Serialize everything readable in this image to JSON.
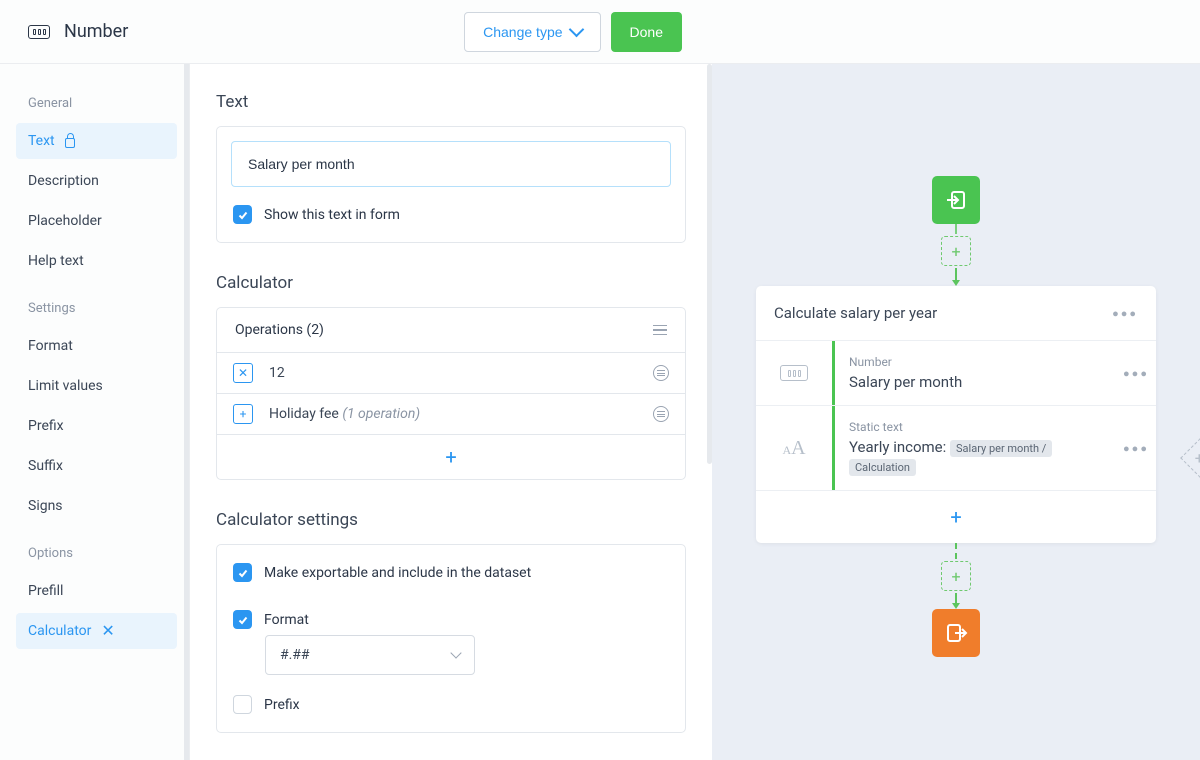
{
  "header": {
    "title": "Number",
    "change_type": "Change type",
    "done": "Done"
  },
  "sidebar": {
    "sections": [
      {
        "label": "General",
        "items": [
          {
            "label": "Text",
            "active": true,
            "locked": true
          },
          {
            "label": "Description"
          },
          {
            "label": "Placeholder"
          },
          {
            "label": "Help text"
          }
        ]
      },
      {
        "label": "Settings",
        "items": [
          {
            "label": "Format"
          },
          {
            "label": "Limit values"
          },
          {
            "label": "Prefix"
          },
          {
            "label": "Suffix"
          },
          {
            "label": "Signs"
          }
        ]
      },
      {
        "label": "Options",
        "items": [
          {
            "label": "Prefill"
          },
          {
            "label": "Calculator",
            "active": true,
            "closable": true
          }
        ]
      }
    ]
  },
  "text_section": {
    "title": "Text",
    "value": "Salary per month",
    "show_in_form_label": "Show this text in form"
  },
  "calculator_section": {
    "title": "Calculator",
    "operations_label": "Operations (2)",
    "rows": [
      {
        "op": "×",
        "label": "12",
        "detail": ""
      },
      {
        "op": "+",
        "label": "Holiday fee",
        "detail": "(1 operation)"
      }
    ]
  },
  "calc_settings": {
    "title": "Calculator settings",
    "exportable": "Make exportable and include in the dataset",
    "format_label": "Format",
    "format_value": "#.##",
    "prefix_label": "Prefix"
  },
  "canvas": {
    "card_title": "Calculate salary per year",
    "rows": [
      {
        "kicker": "Number",
        "title": "Salary per month"
      },
      {
        "kicker": "Static text",
        "title": "Yearly income:",
        "chips": [
          "Salary per month / ",
          "Calculation"
        ]
      }
    ]
  }
}
